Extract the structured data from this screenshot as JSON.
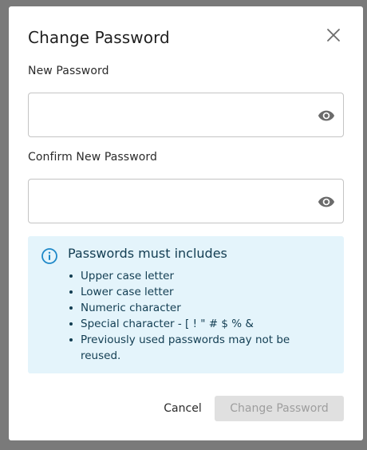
{
  "dialog": {
    "title": "Change Password",
    "close_icon": "close-icon"
  },
  "fields": {
    "new_password": {
      "label": "New Password",
      "value": "",
      "placeholder": "",
      "visibility_icon": "eye-icon"
    },
    "confirm_password": {
      "label": "Confirm New Password",
      "value": "",
      "placeholder": "",
      "visibility_icon": "eye-icon"
    }
  },
  "requirements": {
    "icon": "info-icon",
    "title": "Passwords must includes",
    "items": [
      "Upper case letter",
      "Lower case letter",
      "Numeric character",
      "Special character - [ ! \" # $ % &",
      "Previously used passwords may not be reused."
    ],
    "colors": {
      "background": "#e4f4fb",
      "text": "#123d52",
      "icon": "#1e88c8"
    }
  },
  "actions": {
    "cancel_label": "Cancel",
    "submit_label": "Change Password",
    "submit_disabled": true
  }
}
